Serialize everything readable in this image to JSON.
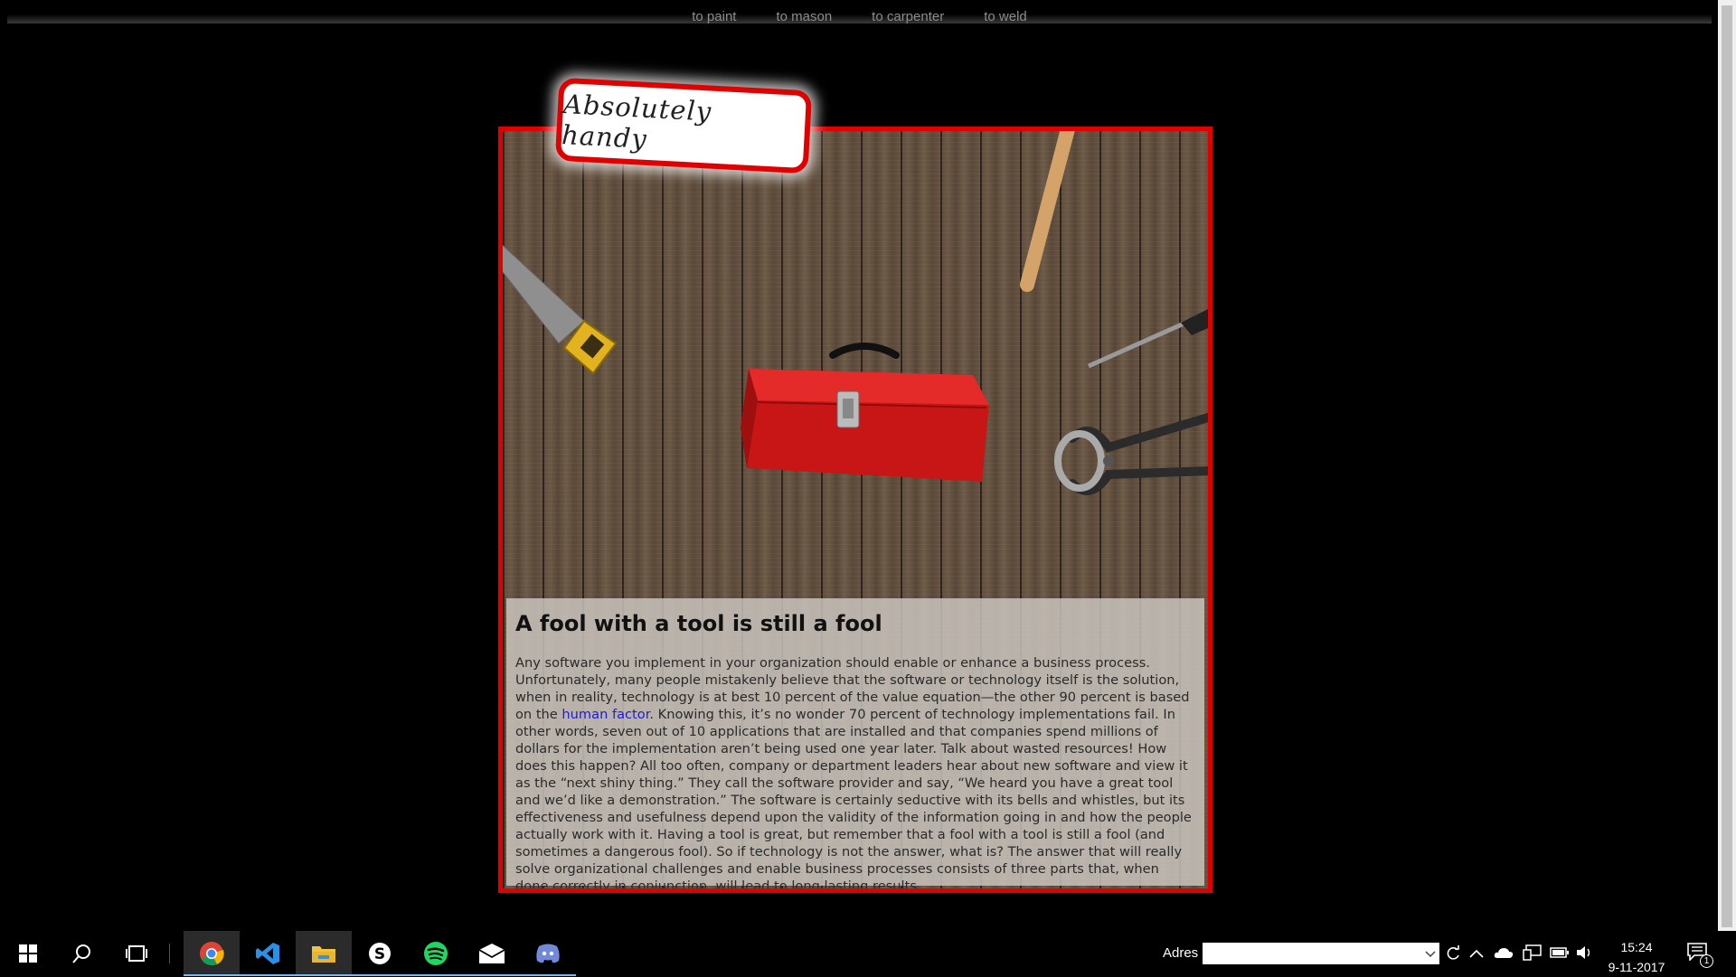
{
  "nav": {
    "links": [
      {
        "label": "to paint"
      },
      {
        "label": "to mason"
      },
      {
        "label": "to carpenter"
      },
      {
        "label": "to weld"
      }
    ]
  },
  "badge": {
    "text": "Absolutely handy"
  },
  "article": {
    "heading": "A fool with a tool is still a fool",
    "text_before_link": "Any software you implement in your organization should enable or enhance a business process. Unfortunately, many people mistakenly believe that the software or technology itself is the solution, when in reality, technology is at best 10 percent of the value equation—the other 90 percent is based on the ",
    "link": "human factor",
    "text_after_link": ". Knowing this, it’s no wonder 70 percent of technology implementations fail. In other words, seven out of 10 applications that are installed and that companies spend millions of dollars for the implementation aren’t being used one year later. Talk about wasted resources! How does this happen? All too often, company or department leaders hear about new software and view it as the “next shiny thing.” They call the software provider and say, “We heard you have a great tool and we’d like a demonstration.” The software is certainly seductive with its bells and whistles, but its effectiveness and usefulness depend upon the validity of the information going in and how the people actually work with it. Having a tool is great, but remember that a fool with a tool is still a fool (and sometimes a dangerous fool). So if technology is not the answer, what is? The answer that will really solve organizational challenges and enable business processes consists of three parts that, when done correctly in conjunction, will lead to long lasting results."
  },
  "taskbar": {
    "apps": [
      {
        "icon": "chrome-icon",
        "active": true
      },
      {
        "icon": "vscode-icon"
      },
      {
        "icon": "file-explorer-icon"
      },
      {
        "icon": "skype-icon"
      },
      {
        "icon": "spotify-icon"
      },
      {
        "icon": "mail-icon"
      },
      {
        "icon": "discord-icon"
      }
    ],
    "address_label": "Adres",
    "address_value": "",
    "time": "15:24",
    "date": "9-11-2017",
    "notification_count": "1"
  },
  "colors": {
    "frame": "#e00000",
    "link": "#1b1bd8",
    "toolbox": "#d81a1a"
  }
}
